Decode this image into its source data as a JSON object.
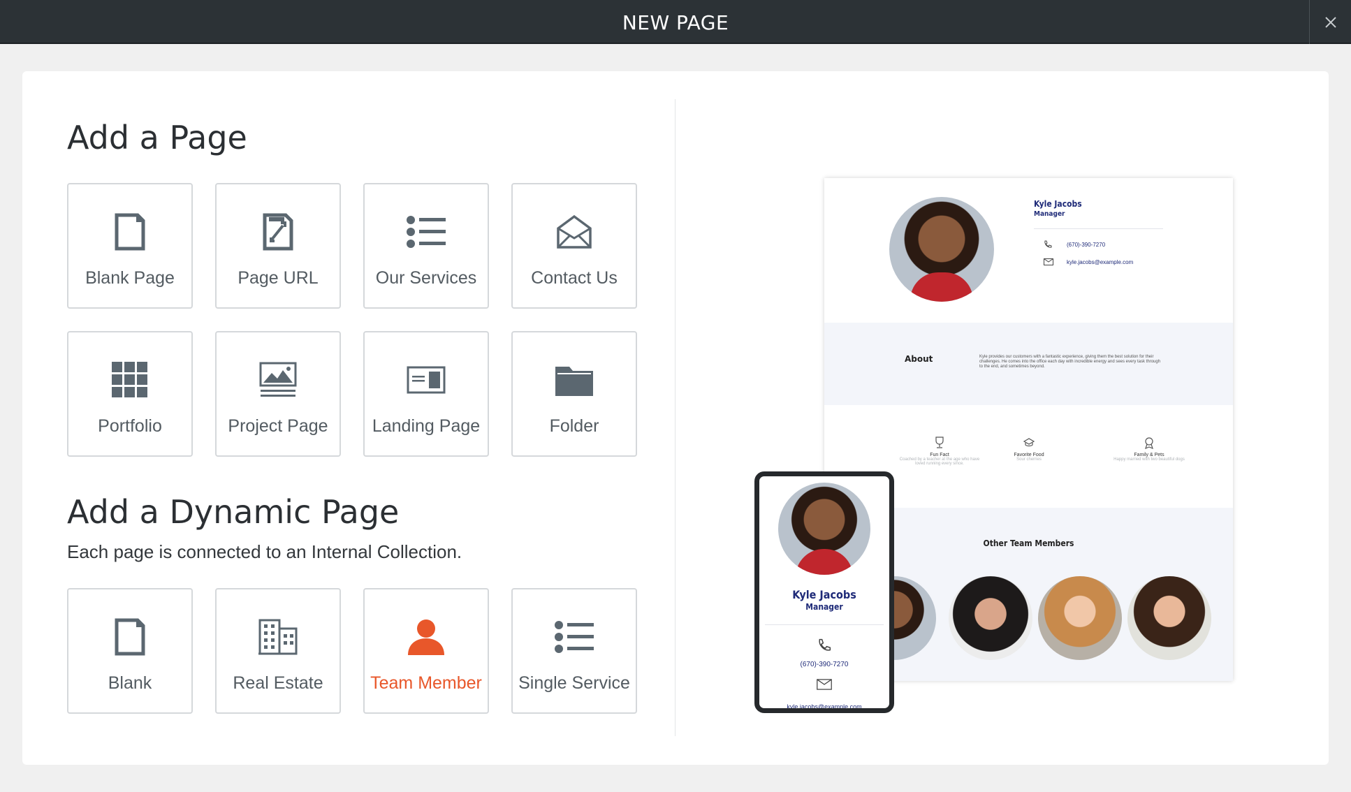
{
  "window": {
    "title": "NEW PAGE"
  },
  "add_page": {
    "heading": "Add a Page",
    "tiles": [
      {
        "label": "Blank Page",
        "icon": "blank-page-icon"
      },
      {
        "label": "Page URL",
        "icon": "page-url-icon"
      },
      {
        "label": "Our Services",
        "icon": "list-icon"
      },
      {
        "label": "Contact Us",
        "icon": "envelope-icon"
      },
      {
        "label": "Portfolio",
        "icon": "grid-icon"
      },
      {
        "label": "Project Page",
        "icon": "image-icon"
      },
      {
        "label": "Landing Page",
        "icon": "landing-page-icon"
      },
      {
        "label": "Folder",
        "icon": "folder-icon"
      }
    ]
  },
  "dynamic_page": {
    "heading": "Add a Dynamic Page",
    "subtext": "Each page is connected to an Internal Collection.",
    "tiles": [
      {
        "label": "Blank",
        "icon": "blank-page-icon"
      },
      {
        "label": "Real Estate",
        "icon": "building-icon"
      },
      {
        "label": "Team Member",
        "icon": "person-icon",
        "selected": true
      },
      {
        "label": "Single Service",
        "icon": "list-icon"
      }
    ]
  },
  "preview": {
    "name": "Kyle Jacobs",
    "role": "Manager",
    "phone": "(670)-390-7270",
    "email": "kyle.jacobs@example.com",
    "about_label": "About",
    "about_text": "Kyle provides our customers with a fantastic experience, giving them the best solution for their challenges. He comes into the office each day with incredible energy and sees every task through to the end, and sometimes beyond.",
    "facts": [
      {
        "title": "Fun Fact",
        "text": "Coached by a teacher at the age who have loved running every since.",
        "icon": "trophy-icon"
      },
      {
        "title": "Favorite Food",
        "text": "Sour cherries",
        "icon": "food-icon"
      },
      {
        "title": "Family & Pets",
        "text": "Happy married with two beautiful dogs",
        "icon": "award-icon"
      }
    ],
    "others_heading": "Other Team Members"
  },
  "colors": {
    "accent": "#e8572a",
    "icon_gray": "#5b6770",
    "navy": "#1e2a78",
    "titlebar": "#2c3236"
  }
}
